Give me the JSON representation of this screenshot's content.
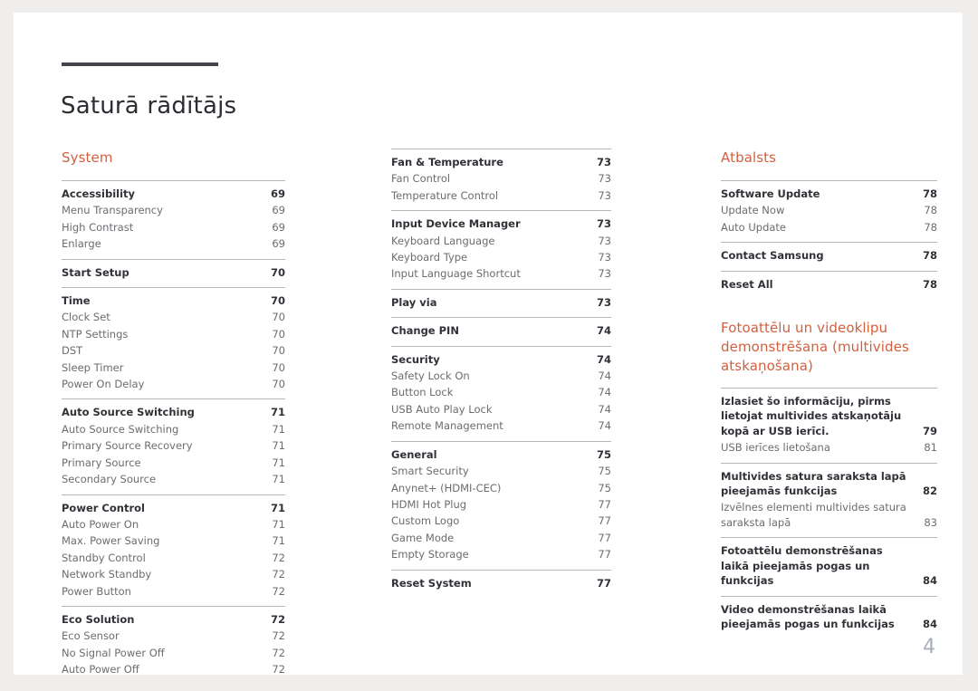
{
  "document": {
    "title": "Saturā rādītājs",
    "page_number": "4",
    "accent_color": "#d2603f",
    "rule_color": "#45434d"
  },
  "columns": [
    {
      "id": "column-left",
      "blocks": [
        {
          "heading": "System",
          "groups": [
            {
              "entries": [
                {
                  "label": "Accessibility",
                  "page": "69",
                  "level": "main"
                },
                {
                  "label": "Menu Transparency",
                  "page": "69",
                  "level": "sub"
                },
                {
                  "label": "High Contrast",
                  "page": "69",
                  "level": "sub"
                },
                {
                  "label": "Enlarge",
                  "page": "69",
                  "level": "sub"
                }
              ]
            },
            {
              "entries": [
                {
                  "label": "Start Setup",
                  "page": "70",
                  "level": "main"
                }
              ]
            },
            {
              "entries": [
                {
                  "label": "Time",
                  "page": "70",
                  "level": "main"
                },
                {
                  "label": "Clock Set",
                  "page": "70",
                  "level": "sub"
                },
                {
                  "label": "NTP Settings",
                  "page": "70",
                  "level": "sub"
                },
                {
                  "label": "DST",
                  "page": "70",
                  "level": "sub"
                },
                {
                  "label": "Sleep Timer",
                  "page": "70",
                  "level": "sub"
                },
                {
                  "label": "Power On Delay",
                  "page": "70",
                  "level": "sub"
                }
              ]
            },
            {
              "entries": [
                {
                  "label": "Auto Source Switching",
                  "page": "71",
                  "level": "main"
                },
                {
                  "label": "Auto Source Switching",
                  "page": "71",
                  "level": "sub"
                },
                {
                  "label": "Primary Source Recovery",
                  "page": "71",
                  "level": "sub"
                },
                {
                  "label": "Primary Source",
                  "page": "71",
                  "level": "sub"
                },
                {
                  "label": "Secondary Source",
                  "page": "71",
                  "level": "sub"
                }
              ]
            },
            {
              "entries": [
                {
                  "label": "Power Control",
                  "page": "71",
                  "level": "main"
                },
                {
                  "label": "Auto Power On",
                  "page": "71",
                  "level": "sub"
                },
                {
                  "label": "Max. Power Saving",
                  "page": "71",
                  "level": "sub"
                },
                {
                  "label": "Standby Control",
                  "page": "72",
                  "level": "sub"
                },
                {
                  "label": "Network Standby",
                  "page": "72",
                  "level": "sub"
                },
                {
                  "label": "Power Button",
                  "page": "72",
                  "level": "sub"
                }
              ]
            },
            {
              "entries": [
                {
                  "label": "Eco Solution",
                  "page": "72",
                  "level": "main"
                },
                {
                  "label": "Eco Sensor",
                  "page": "72",
                  "level": "sub"
                },
                {
                  "label": "No Signal Power Off",
                  "page": "72",
                  "level": "sub"
                },
                {
                  "label": "Auto Power Off",
                  "page": "72",
                  "level": "sub"
                }
              ]
            }
          ]
        }
      ]
    },
    {
      "id": "column-middle",
      "blocks": [
        {
          "heading": "",
          "groups": [
            {
              "entries": [
                {
                  "label": "Fan & Temperature",
                  "page": "73",
                  "level": "main"
                },
                {
                  "label": "Fan Control",
                  "page": "73",
                  "level": "sub"
                },
                {
                  "label": "Temperature Control",
                  "page": "73",
                  "level": "sub"
                }
              ]
            },
            {
              "entries": [
                {
                  "label": "Input Device Manager",
                  "page": "73",
                  "level": "main"
                },
                {
                  "label": "Keyboard Language",
                  "page": "73",
                  "level": "sub"
                },
                {
                  "label": "Keyboard Type",
                  "page": "73",
                  "level": "sub"
                },
                {
                  "label": "Input Language Shortcut",
                  "page": "73",
                  "level": "sub"
                }
              ]
            },
            {
              "entries": [
                {
                  "label": "Play via",
                  "page": "73",
                  "level": "main"
                }
              ]
            },
            {
              "entries": [
                {
                  "label": "Change PIN",
                  "page": "74",
                  "level": "main"
                }
              ]
            },
            {
              "entries": [
                {
                  "label": "Security",
                  "page": "74",
                  "level": "main"
                },
                {
                  "label": "Safety Lock On",
                  "page": "74",
                  "level": "sub"
                },
                {
                  "label": "Button Lock",
                  "page": "74",
                  "level": "sub"
                },
                {
                  "label": "USB Auto Play Lock",
                  "page": "74",
                  "level": "sub"
                },
                {
                  "label": "Remote Management",
                  "page": "74",
                  "level": "sub"
                }
              ]
            },
            {
              "entries": [
                {
                  "label": "General",
                  "page": "75",
                  "level": "main"
                },
                {
                  "label": "Smart Security",
                  "page": "75",
                  "level": "sub"
                },
                {
                  "label": "Anynet+ (HDMI-CEC)",
                  "page": "75",
                  "level": "sub"
                },
                {
                  "label": "HDMI Hot Plug",
                  "page": "77",
                  "level": "sub"
                },
                {
                  "label": "Custom Logo",
                  "page": "77",
                  "level": "sub"
                },
                {
                  "label": "Game Mode",
                  "page": "77",
                  "level": "sub"
                },
                {
                  "label": "Empty Storage",
                  "page": "77",
                  "level": "sub"
                }
              ]
            },
            {
              "entries": [
                {
                  "label": "Reset System",
                  "page": "77",
                  "level": "main"
                }
              ]
            }
          ]
        }
      ]
    },
    {
      "id": "column-right",
      "blocks": [
        {
          "heading": "Atbalsts",
          "groups": [
            {
              "entries": [
                {
                  "label": "Software Update",
                  "page": "78",
                  "level": "main"
                },
                {
                  "label": "Update Now",
                  "page": "78",
                  "level": "sub"
                },
                {
                  "label": "Auto Update",
                  "page": "78",
                  "level": "sub"
                }
              ]
            },
            {
              "entries": [
                {
                  "label": "Contact Samsung",
                  "page": "78",
                  "level": "main"
                }
              ]
            },
            {
              "entries": [
                {
                  "label": "Reset All",
                  "page": "78",
                  "level": "main"
                }
              ]
            }
          ]
        },
        {
          "heading": "Fotoattēlu un videoklipu demonstrēšana (multivides atskaņošana)",
          "groups": [
            {
              "entries": [
                {
                  "label": "Izlasiet šo informāciju, pirms lietojat multivides atskaņotāju kopā ar USB ierīci.",
                  "page": "79",
                  "level": "main"
                },
                {
                  "label": "USB ierīces lietošana",
                  "page": "81",
                  "level": "sub"
                }
              ]
            },
            {
              "entries": [
                {
                  "label": "Multivides satura saraksta lapā pieejamās funkcijas",
                  "page": "82",
                  "level": "main"
                },
                {
                  "label": "Izvēlnes elementi multivides satura saraksta lapā",
                  "page": "83",
                  "level": "sub"
                }
              ]
            },
            {
              "entries": [
                {
                  "label": "Fotoattēlu demonstrēšanas laikā pieejamās pogas un funkcijas",
                  "page": "84",
                  "level": "main"
                }
              ]
            },
            {
              "entries": [
                {
                  "label": "Video demonstrēšanas laikā pieejamās pogas un funkcijas",
                  "page": "84",
                  "level": "main"
                }
              ]
            }
          ]
        }
      ]
    }
  ]
}
